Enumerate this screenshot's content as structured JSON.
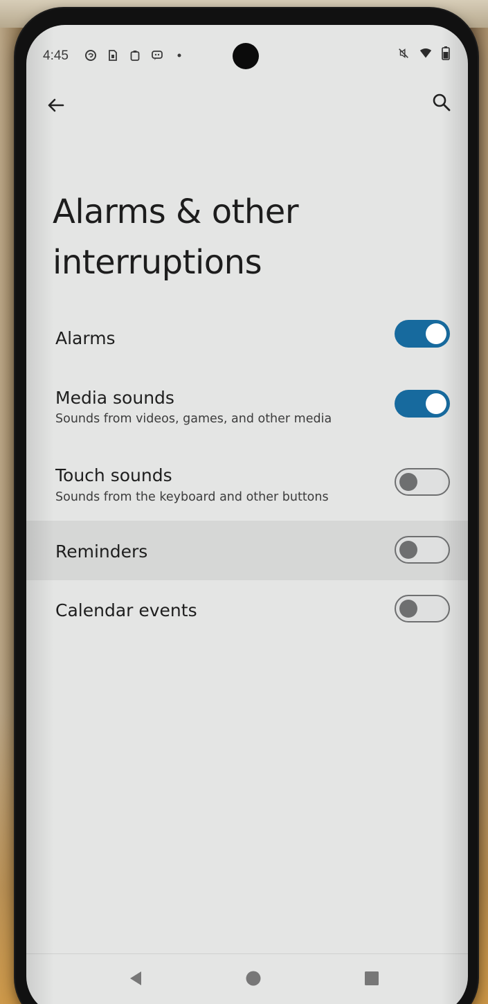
{
  "status_bar": {
    "time": "4:45",
    "left_icons": [
      "threads-icon",
      "sim-icon",
      "clipboard-icon",
      "messages-icon",
      "dot-icon"
    ],
    "right_icons": [
      "mute-icon",
      "wifi-icon",
      "battery-icon"
    ]
  },
  "app_bar": {
    "back_icon": "arrow-back-icon",
    "search_icon": "search-icon"
  },
  "page": {
    "title": "Alarms & other interruptions"
  },
  "settings": [
    {
      "label": "Alarms",
      "summary": "",
      "enabled": true
    },
    {
      "label": "Media sounds",
      "summary": "Sounds from videos, games, and other media",
      "enabled": true
    },
    {
      "label": "Touch sounds",
      "summary": "Sounds from the keyboard and other buttons",
      "enabled": false
    },
    {
      "label": "Reminders",
      "summary": "",
      "enabled": false
    },
    {
      "label": "Calendar events",
      "summary": "",
      "enabled": false
    }
  ],
  "nav_bar": {
    "buttons": [
      "nav-back-icon",
      "nav-home-icon",
      "nav-recents-icon"
    ]
  },
  "colors": {
    "switch_on": "#176a9e",
    "switch_off_track": "#dfe0e0",
    "switch_off_outline": "#6e6f70",
    "screen_bg": "#e4e5e4"
  }
}
